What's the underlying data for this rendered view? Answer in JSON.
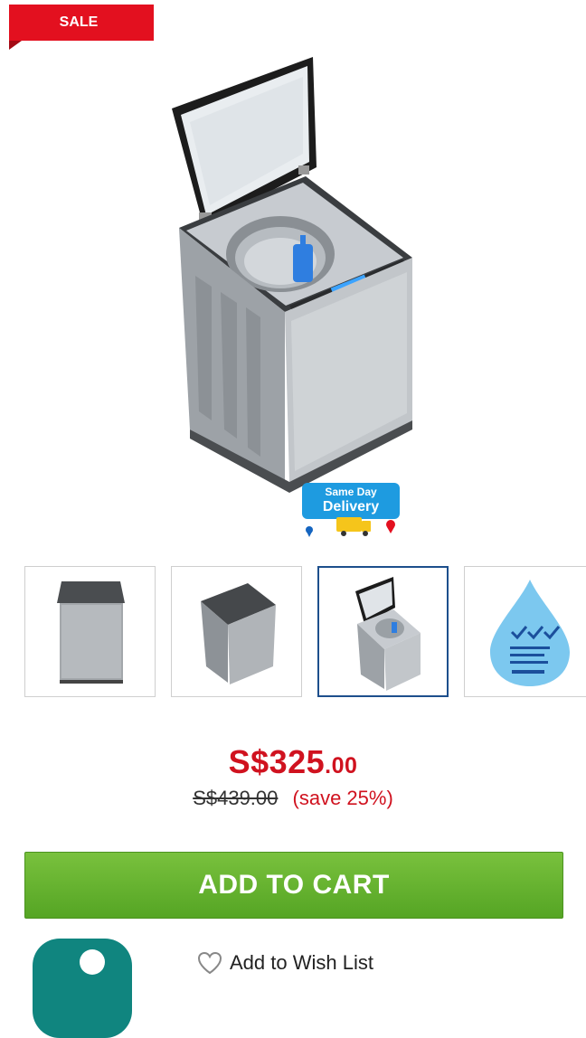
{
  "badge": {
    "sale": "SALE"
  },
  "delivery_badge": {
    "line1": "Same Day",
    "line2": "Delivery"
  },
  "thumbnails": [
    {
      "name": "thumb-closed-front",
      "active": false
    },
    {
      "name": "thumb-closed-angled",
      "active": false
    },
    {
      "name": "thumb-open-lid",
      "active": true
    },
    {
      "name": "thumb-water-efficiency",
      "active": false
    }
  ],
  "price": {
    "currency_main": "S$325",
    "cents": ".00",
    "original": "S$439.00",
    "save": "(save 25%)"
  },
  "actions": {
    "add_to_cart": "ADD TO CART",
    "wishlist": "Add to Wish List"
  },
  "colors": {
    "sale_red": "#e3101f",
    "price_red": "#d0121f",
    "cart_green": "#5fb12c",
    "chat_teal": "#10857f",
    "active_thumb_border": "#1d4f8c"
  },
  "icons": [
    "heart-outline-icon",
    "chat-icon",
    "location-pin-icon"
  ]
}
